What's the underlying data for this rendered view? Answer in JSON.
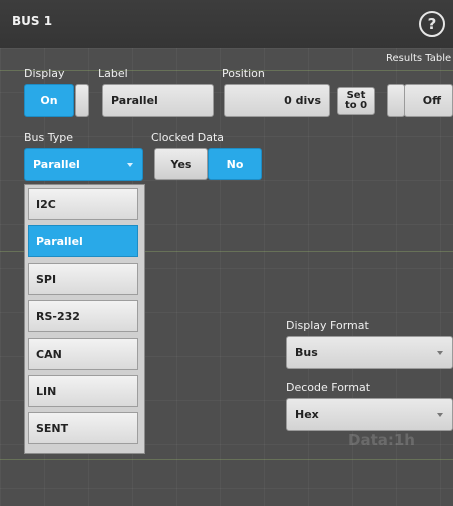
{
  "header": {
    "title": "BUS 1",
    "help_icon": "question-circle-icon"
  },
  "display": {
    "label": "Display",
    "value": "On"
  },
  "label_field": {
    "label": "Label",
    "value": "Parallel"
  },
  "position": {
    "label": "Position",
    "value": "0 divs",
    "set_zero": "Set to 0"
  },
  "results_table": {
    "label": "Results Table",
    "value": "Off"
  },
  "bus_type": {
    "label": "Bus Type",
    "value": "Parallel",
    "options": [
      "I2C",
      "Parallel",
      "SPI",
      "RS-232",
      "CAN",
      "LIN",
      "SENT"
    ],
    "selected": "Parallel"
  },
  "clocked_data": {
    "label": "Clocked Data",
    "yes": "Yes",
    "no": "No",
    "selected": "No"
  },
  "display_format": {
    "label": "Display Format",
    "value": "Bus"
  },
  "decode_format": {
    "label": "Decode Format",
    "value": "Hex"
  },
  "background_readout": "Data:1h",
  "colors": {
    "accent": "#29a9e8",
    "header": "#3a3a3a",
    "panel": "#4e4e4e",
    "control": "#dcdcdc"
  }
}
